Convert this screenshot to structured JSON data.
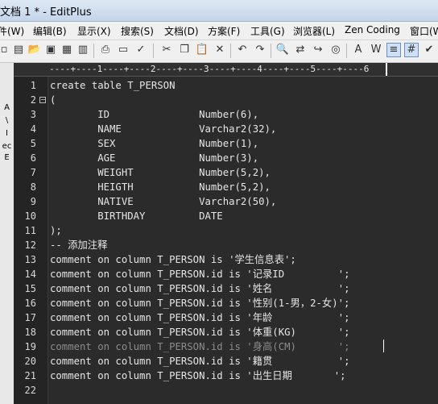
{
  "window": {
    "title": "文档 1 * - EditPlus"
  },
  "menu": [
    "件(W)",
    "编辑(B)",
    "显示(X)",
    "搜索(S)",
    "文档(D)",
    "方案(F)",
    "工具(G)",
    "浏览器(L)",
    "Zen Coding",
    "窗口(W"
  ],
  "toolbar": {
    "icons": [
      "new-file-icon",
      "open-folder-icon",
      "open-icon",
      "save-icon",
      "save-all-icon",
      "print-icon",
      "print-preview-icon",
      "spell-check-icon",
      "cut-icon",
      "copy-icon",
      "paste-icon",
      "delete-icon",
      "undo-icon",
      "redo-icon",
      "find-icon",
      "replace-icon",
      "goto-icon",
      "browser-icon",
      "font-icon",
      "word-wrap-icon",
      "ruler-icon",
      "line-number-icon",
      "check-icon"
    ]
  },
  "left_panel": {
    "labels": [
      "A",
      "\\",
      "I",
      "ec",
      "E"
    ]
  },
  "ruler": {
    "text": "----+----1----+----2----+----3----+----4----+----5----+----6",
    "marker": "5"
  },
  "editor": {
    "lines": [
      {
        "n": "1",
        "text": "create table T_PERSON"
      },
      {
        "n": "2",
        "text": "("
      },
      {
        "n": "3",
        "text": "        ID               Number(6),"
      },
      {
        "n": "4",
        "text": "        NAME             Varchar2(32),"
      },
      {
        "n": "5",
        "text": "        SEX              Number(1),"
      },
      {
        "n": "6",
        "text": "        AGE              Number(3),"
      },
      {
        "n": "7",
        "text": "        WEIGHT           Number(5,2),"
      },
      {
        "n": "8",
        "text": "        HEIGTH           Number(5,2),"
      },
      {
        "n": "9",
        "text": "        NATIVE           Varchar2(50),"
      },
      {
        "n": "10",
        "text": "        BIRTHDAY         DATE"
      },
      {
        "n": "11",
        "text": ");"
      },
      {
        "n": "12",
        "text": "-- 添加注释"
      },
      {
        "n": "13",
        "text": "comment on column T_PERSON is '学生信息表';"
      },
      {
        "n": "14",
        "text": "comment on column T_PERSON.id is '记录ID         ';"
      },
      {
        "n": "15",
        "text": "comment on column T_PERSON.id is '姓名           ';"
      },
      {
        "n": "16",
        "text": "comment on column T_PERSON.id is '性别(1-男，2-女)';"
      },
      {
        "n": "17",
        "text": "comment on column T_PERSON.id is '年龄           ';"
      },
      {
        "n": "18",
        "text": "comment on column T_PERSON.id is '体重(KG)       ';"
      },
      {
        "n": "19",
        "text": "comment on column T_PERSON.id is '身高(CM)       ';"
      },
      {
        "n": "20",
        "text": "comment on column T_PERSON.id is '籍贯           ';"
      },
      {
        "n": "21",
        "text": "comment on column T_PERSON.id is '出生日期       ';"
      },
      {
        "n": "22",
        "text": ""
      }
    ]
  },
  "colors": {
    "editor_bg": "#2b2b2b",
    "gutter_bg": "#242424",
    "text": "#e6e6e6",
    "current_line_text": "#8c8c8c"
  }
}
